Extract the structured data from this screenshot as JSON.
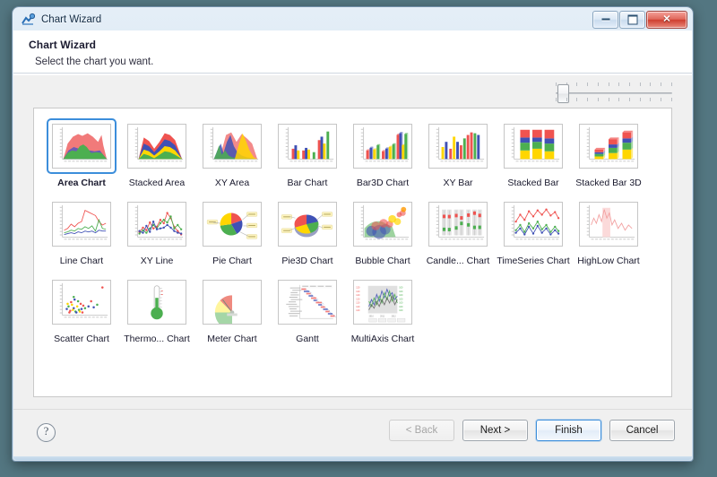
{
  "window": {
    "title": "Chart Wizard",
    "icon": "chart-wizard-icon",
    "controls": {
      "minimize": "minimize",
      "maximize": "maximize",
      "close": "close"
    }
  },
  "header": {
    "title": "Chart Wizard",
    "subtitle": "Select the chart you want."
  },
  "slider": {
    "name": "thumbnail-size-slider",
    "value": 1,
    "min": 1,
    "max": 12,
    "tick_count": 12
  },
  "gallery": {
    "selected": "Area Chart",
    "items": [
      {
        "label": "Area Chart",
        "type": "area",
        "selected": true
      },
      {
        "label": "Stacked Area",
        "type": "stacked-area",
        "selected": false
      },
      {
        "label": "XY Area",
        "type": "xy-area",
        "selected": false
      },
      {
        "label": "Bar Chart",
        "type": "bar",
        "selected": false
      },
      {
        "label": "Bar3D Chart",
        "type": "bar3d",
        "selected": false
      },
      {
        "label": "XY Bar",
        "type": "xy-bar",
        "selected": false
      },
      {
        "label": "Stacked Bar",
        "type": "stacked-bar",
        "selected": false
      },
      {
        "label": "Stacked Bar 3D",
        "type": "stacked-bar3d",
        "selected": false
      },
      {
        "label": "Line Chart",
        "type": "line",
        "selected": false
      },
      {
        "label": "XY Line",
        "type": "xy-line",
        "selected": false
      },
      {
        "label": "Pie Chart",
        "type": "pie",
        "selected": false
      },
      {
        "label": "Pie3D Chart",
        "type": "pie3d",
        "selected": false
      },
      {
        "label": "Bubble Chart",
        "type": "bubble",
        "selected": false
      },
      {
        "label": "Candle... Chart",
        "type": "candle",
        "selected": false
      },
      {
        "label": "TimeSeries Chart",
        "type": "timeseries",
        "selected": false
      },
      {
        "label": "HighLow Chart",
        "type": "highlow",
        "selected": false
      },
      {
        "label": "Scatter Chart",
        "type": "scatter",
        "selected": false
      },
      {
        "label": "Thermo... Chart",
        "type": "thermometer",
        "selected": false
      },
      {
        "label": "Meter Chart",
        "type": "meter",
        "selected": false
      },
      {
        "label": "Gantt",
        "type": "gantt",
        "selected": false
      },
      {
        "label": "MultiAxis Chart",
        "type": "multiaxis",
        "selected": false
      }
    ]
  },
  "footer": {
    "help": "?",
    "buttons": [
      {
        "label": "< Back",
        "state": "disabled"
      },
      {
        "label": "Next >",
        "state": "normal"
      },
      {
        "label": "Finish",
        "state": "default"
      },
      {
        "label": "Cancel",
        "state": "normal"
      }
    ]
  },
  "colors": {
    "accent": "#3c8edb",
    "series_red": "#ef5350",
    "series_green": "#4caf50",
    "series_blue": "#3f51b5",
    "series_yellow": "#ffd600",
    "chart_salmon": "#f17a7a",
    "chart_purple": "#6b5bb5",
    "window_chrome": "#d3e2f0",
    "body_bg": "#f0f0f0",
    "desktop": "#537681"
  }
}
